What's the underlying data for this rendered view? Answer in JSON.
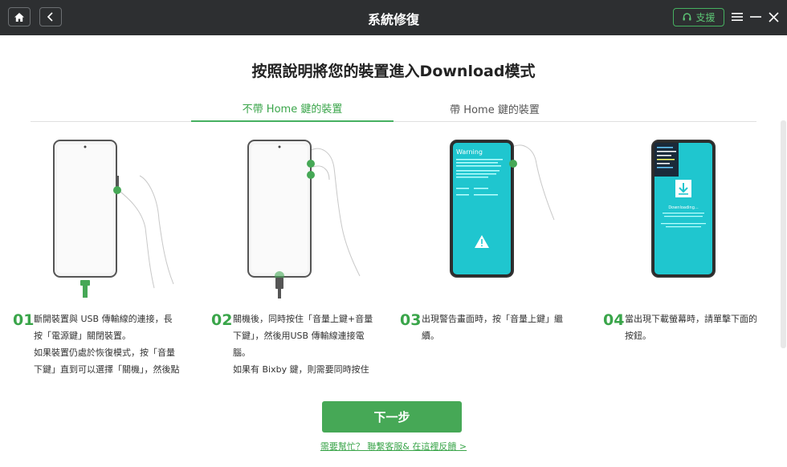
{
  "window": {
    "title": "系統修復"
  },
  "titlebar": {
    "support_label": "支援"
  },
  "page": {
    "heading": "按照說明將您的裝置進入Download模式"
  },
  "tabs": [
    {
      "label": "不帶 Home 鍵的裝置",
      "active": true
    },
    {
      "label": "帶 Home 鍵的裝置",
      "active": false
    }
  ],
  "steps": [
    {
      "number": "01",
      "lines": [
        "斷開裝置與 USB 傳輸線的連接，長",
        "按「電源鍵」關閉裝置。",
        " 如果裝置仍處於恢復模式，按「音量",
        "下鍵」直到可以選擇「關機」，然後點"
      ]
    },
    {
      "number": "02",
      "lines": [
        "關機後，同時按住「音量上鍵+音量",
        "下鍵」，然後用USB 傳輸線連接電",
        "腦。",
        " 如果有 Bixby 鍵，則需要同時按住"
      ]
    },
    {
      "number": "03",
      "lines": [
        "出現警告畫面時，按「音量上鍵」繼",
        "續。"
      ]
    },
    {
      "number": "04",
      "lines": [
        "當出現下載螢幕時，請單擊下面的",
        "按鈕。"
      ]
    }
  ],
  "screen3": {
    "warning_title": "Warning"
  },
  "screen4": {
    "download_text": "Downloading..."
  },
  "actions": {
    "next_label": "下一步",
    "help_link": "需要幫忙？ 聯繫客服& 在這裡反饋 >"
  },
  "colors": {
    "accent": "#46a856",
    "titlebar": "#2d2f31",
    "screen_teal": "#1fc6cf"
  },
  "icons": [
    "home-icon",
    "back-arrow-icon",
    "headset-icon",
    "menu-icon",
    "minimize-icon",
    "close-icon",
    "warning-triangle-icon",
    "download-arrow-icon"
  ]
}
